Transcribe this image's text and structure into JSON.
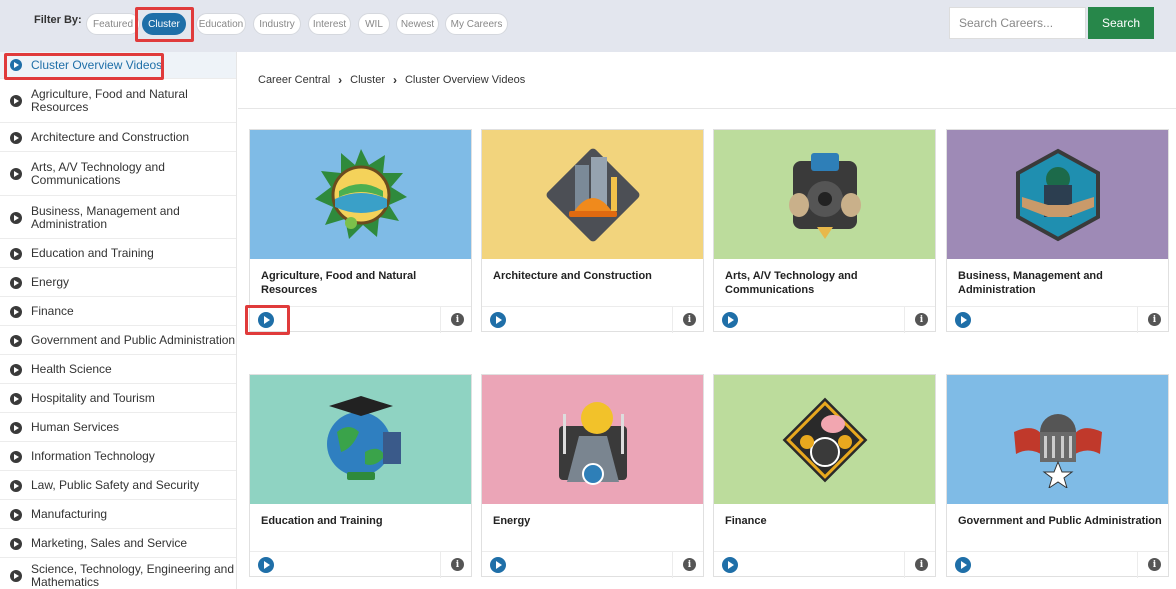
{
  "filter": {
    "label": "Filter By:",
    "pills": [
      "Featured",
      "Cluster",
      "Education",
      "Industry",
      "Interest",
      "WIL",
      "Newest",
      "My Careers"
    ],
    "active": "Cluster"
  },
  "search": {
    "placeholder": "Search Careers...",
    "button": "Search"
  },
  "sidebar": {
    "items": [
      "Cluster Overview Videos",
      "Agriculture, Food and Natural Resources",
      "Architecture and Construction",
      "Arts, A/V Technology and Communications",
      "Business, Management and Administration",
      "Education and Training",
      "Energy",
      "Finance",
      "Government and Public Administration",
      "Health Science",
      "Hospitality and Tourism",
      "Human Services",
      "Information Technology",
      "Law, Public Safety and Security",
      "Manufacturing",
      "Marketing, Sales and Service",
      "Science, Technology, Engineering and Mathematics"
    ]
  },
  "breadcrumb": [
    "Career Central",
    "Cluster",
    "Cluster Overview Videos"
  ],
  "cards": [
    {
      "title": "Agriculture, Food and Natural Resources",
      "bg": "#7fbbe6",
      "icon": "agriculture-emblem-icon"
    },
    {
      "title": "Architecture and Construction",
      "bg": "#f2d47d",
      "icon": "construction-emblem-icon"
    },
    {
      "title": "Arts, A/V Technology and Communications",
      "bg": "#bcdc9c",
      "icon": "arts-av-emblem-icon"
    },
    {
      "title": "Business, Management and Administration",
      "bg": "#9e8ab6",
      "icon": "business-emblem-icon"
    },
    {
      "title": "Education and Training",
      "bg": "#8fd3c2",
      "icon": "education-emblem-icon"
    },
    {
      "title": "Energy",
      "bg": "#eba5b7",
      "icon": "energy-emblem-icon"
    },
    {
      "title": "Finance",
      "bg": "#bcdc9c",
      "icon": "finance-emblem-icon"
    },
    {
      "title": "Government and Public Administration",
      "bg": "#7fbbe6",
      "icon": "government-emblem-icon"
    }
  ],
  "colors": {
    "accent": "#1f6fa8",
    "search_button": "#27874a",
    "highlight": "#e03b3b"
  }
}
